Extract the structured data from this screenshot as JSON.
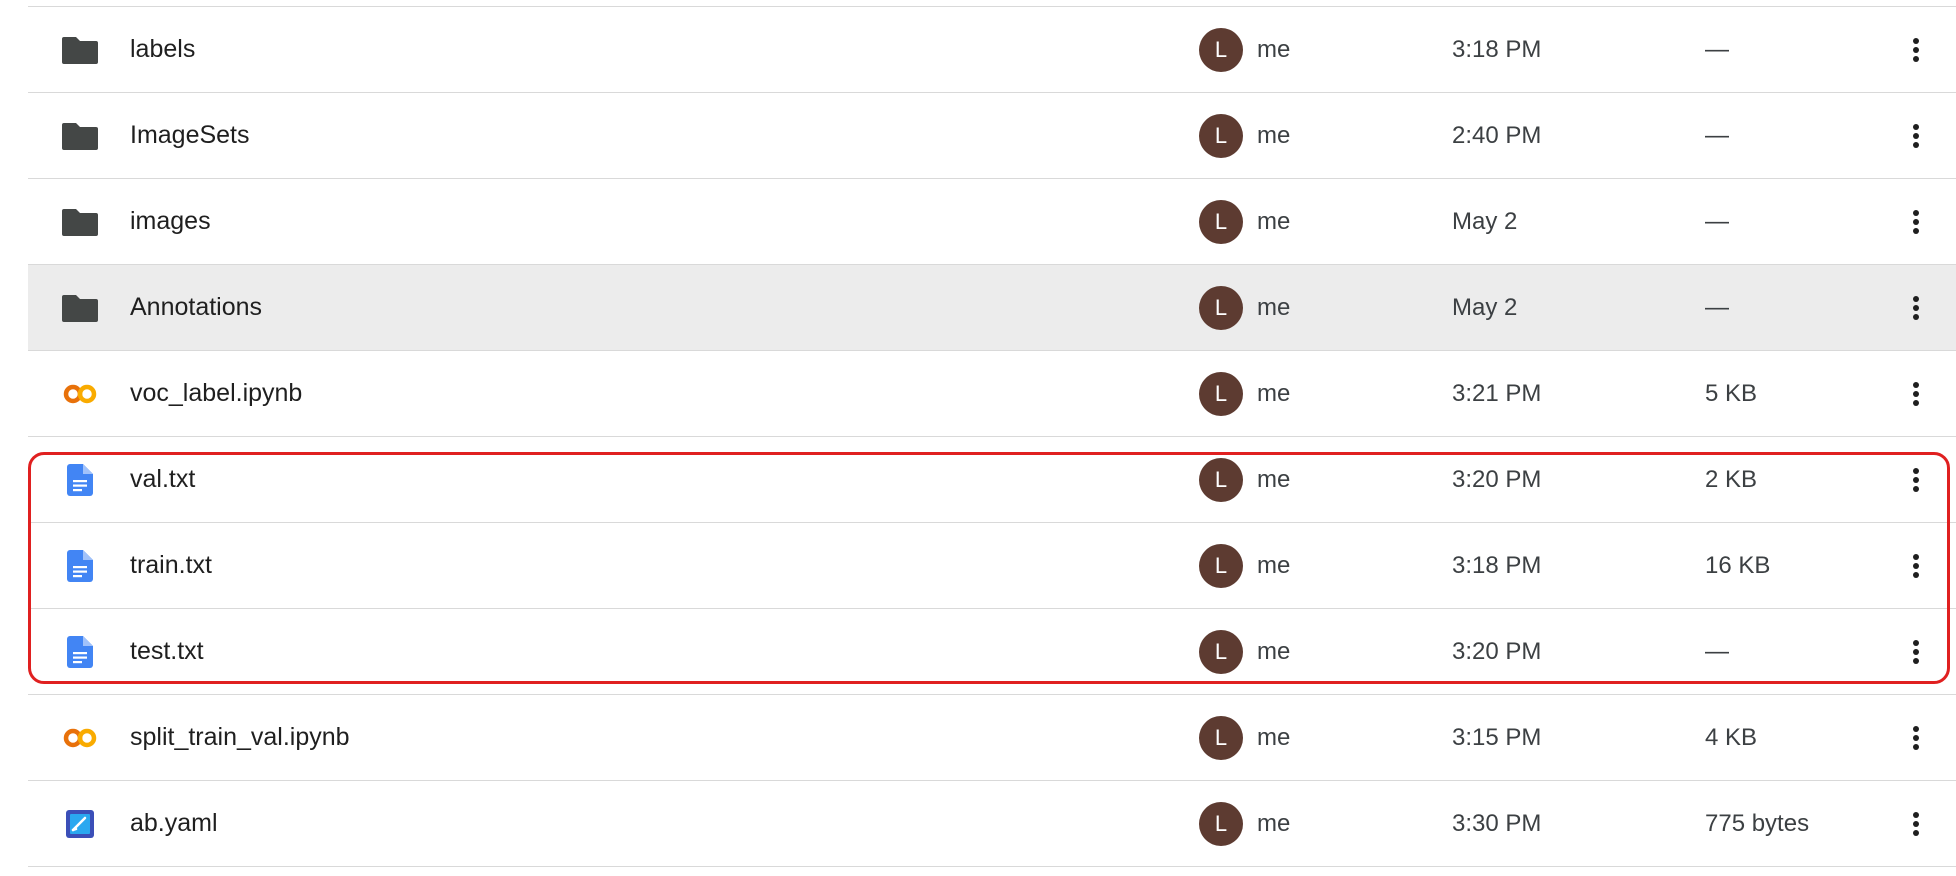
{
  "files": [
    {
      "name": "labels",
      "type": "folder",
      "owner_initial": "L",
      "owner": "me",
      "modified": "3:18 PM",
      "size": "—",
      "selected": false
    },
    {
      "name": "ImageSets",
      "type": "folder",
      "owner_initial": "L",
      "owner": "me",
      "modified": "2:40 PM",
      "size": "—",
      "selected": false
    },
    {
      "name": "images",
      "type": "folder",
      "owner_initial": "L",
      "owner": "me",
      "modified": "May 2",
      "size": "—",
      "selected": false
    },
    {
      "name": "Annotations",
      "type": "folder",
      "owner_initial": "L",
      "owner": "me",
      "modified": "May 2",
      "size": "—",
      "selected": true
    },
    {
      "name": "voc_label.ipynb",
      "type": "colab",
      "owner_initial": "L",
      "owner": "me",
      "modified": "3:21 PM",
      "size": "5 KB",
      "selected": false
    },
    {
      "name": "val.txt",
      "type": "doc",
      "owner_initial": "L",
      "owner": "me",
      "modified": "3:20 PM",
      "size": "2 KB",
      "selected": false
    },
    {
      "name": "train.txt",
      "type": "doc",
      "owner_initial": "L",
      "owner": "me",
      "modified": "3:18 PM",
      "size": "16 KB",
      "selected": false
    },
    {
      "name": "test.txt",
      "type": "doc",
      "owner_initial": "L",
      "owner": "me",
      "modified": "3:20 PM",
      "size": "—",
      "selected": false
    },
    {
      "name": "split_train_val.ipynb",
      "type": "colab",
      "owner_initial": "L",
      "owner": "me",
      "modified": "3:15 PM",
      "size": "4 KB",
      "selected": false
    },
    {
      "name": "ab.yaml",
      "type": "yaml",
      "owner_initial": "L",
      "owner": "me",
      "modified": "3:30 PM",
      "size": "775 bytes",
      "selected": false
    }
  ],
  "icons": {
    "folder": "folder-icon",
    "colab": "colab-icon",
    "doc": "text-document-icon",
    "yaml": "yaml-file-icon",
    "more": "more-vertical-icon"
  },
  "colors": {
    "folder": "#444746",
    "colab_orange": "#f9ab00",
    "colab_dark": "#e8710a",
    "doc_blue": "#4285f4",
    "avatar_bg": "#5d3b31",
    "highlight_border": "#e02020",
    "selected_row_bg": "#ececec"
  }
}
